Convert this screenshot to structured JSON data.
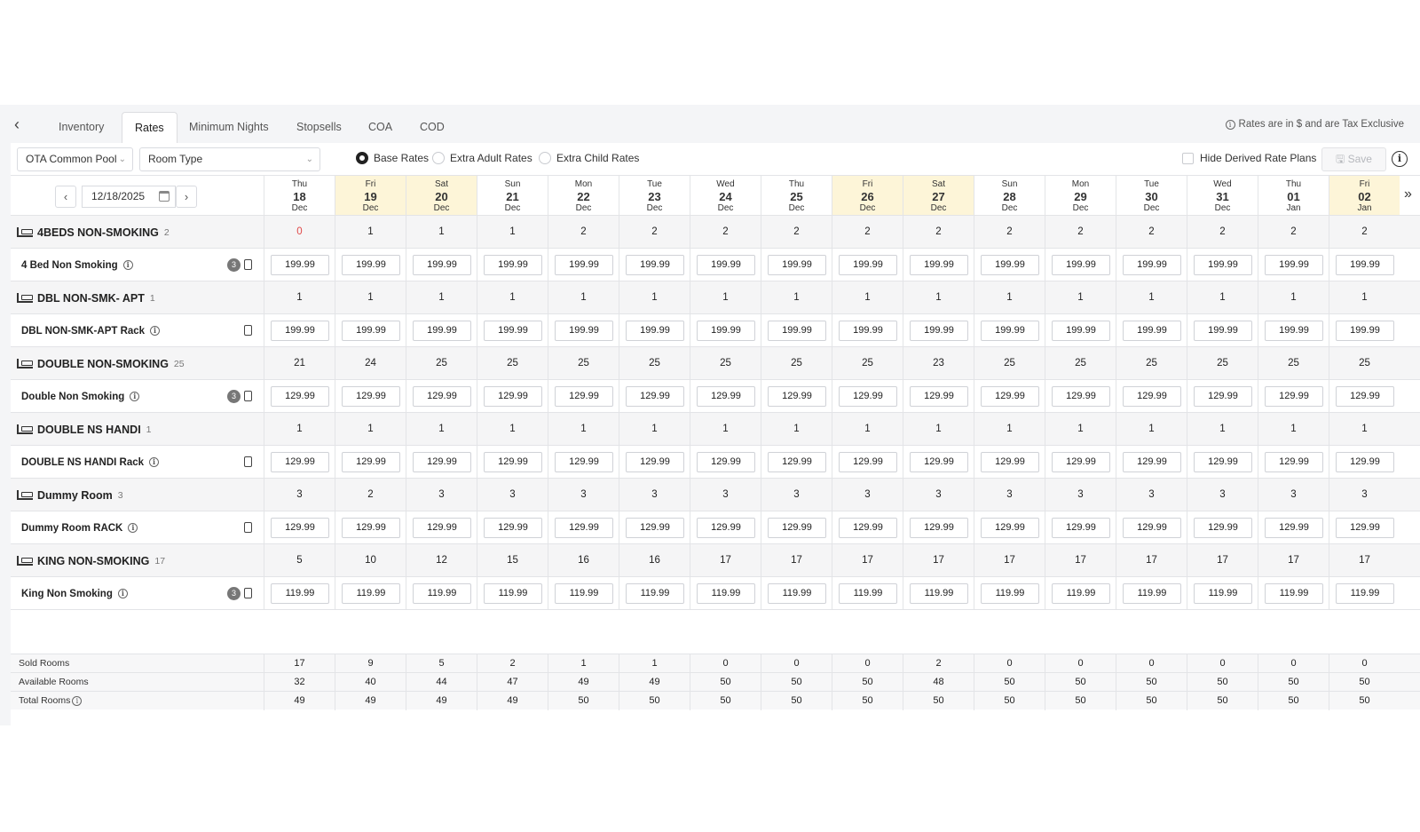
{
  "tabs": [
    "Inventory",
    "Rates",
    "Minimum Nights",
    "Stopsells",
    "COA",
    "COD"
  ],
  "active_tab": "Rates",
  "tax_note": "Rates are in $ and are Tax Exclusive",
  "toolbar": {
    "pool_select": "OTA Common Pool",
    "room_type_select": "Room Type",
    "radios": [
      {
        "label": "Base Rates",
        "selected": true
      },
      {
        "label": "Extra Adult Rates",
        "selected": false
      },
      {
        "label": "Extra Child Rates",
        "selected": false
      }
    ],
    "hide_derived_label": "Hide Derived Rate Plans",
    "save_label": "Save"
  },
  "date_input": "12/18/2025",
  "days": [
    {
      "dow": "Thu",
      "day": "18",
      "mon": "Dec",
      "weekend": false
    },
    {
      "dow": "Fri",
      "day": "19",
      "mon": "Dec",
      "weekend": true
    },
    {
      "dow": "Sat",
      "day": "20",
      "mon": "Dec",
      "weekend": true
    },
    {
      "dow": "Sun",
      "day": "21",
      "mon": "Dec",
      "weekend": false
    },
    {
      "dow": "Mon",
      "day": "22",
      "mon": "Dec",
      "weekend": false
    },
    {
      "dow": "Tue",
      "day": "23",
      "mon": "Dec",
      "weekend": false
    },
    {
      "dow": "Wed",
      "day": "24",
      "mon": "Dec",
      "weekend": false
    },
    {
      "dow": "Thu",
      "day": "25",
      "mon": "Dec",
      "weekend": false
    },
    {
      "dow": "Fri",
      "day": "26",
      "mon": "Dec",
      "weekend": true
    },
    {
      "dow": "Sat",
      "day": "27",
      "mon": "Dec",
      "weekend": true
    },
    {
      "dow": "Sun",
      "day": "28",
      "mon": "Dec",
      "weekend": false
    },
    {
      "dow": "Mon",
      "day": "29",
      "mon": "Dec",
      "weekend": false
    },
    {
      "dow": "Tue",
      "day": "30",
      "mon": "Dec",
      "weekend": false
    },
    {
      "dow": "Wed",
      "day": "31",
      "mon": "Dec",
      "weekend": false
    },
    {
      "dow": "Thu",
      "day": "01",
      "mon": "Jan",
      "weekend": false
    },
    {
      "dow": "Fri",
      "day": "02",
      "mon": "Jan",
      "weekend": true
    }
  ],
  "room_types": [
    {
      "name": "4BEDS NON-SMOKING",
      "count": "2",
      "availability": [
        "0",
        "1",
        "1",
        "1",
        "2",
        "2",
        "2",
        "2",
        "2",
        "2",
        "2",
        "2",
        "2",
        "2",
        "2",
        "2"
      ],
      "rate_plan": {
        "name": "4 Bed Non Smoking",
        "badge": "3",
        "values": [
          "199.99",
          "199.99",
          "199.99",
          "199.99",
          "199.99",
          "199.99",
          "199.99",
          "199.99",
          "199.99",
          "199.99",
          "199.99",
          "199.99",
          "199.99",
          "199.99",
          "199.99",
          "199.99"
        ]
      }
    },
    {
      "name": "DBL NON-SMK- APT",
      "count": "1",
      "availability": [
        "1",
        "1",
        "1",
        "1",
        "1",
        "1",
        "1",
        "1",
        "1",
        "1",
        "1",
        "1",
        "1",
        "1",
        "1",
        "1"
      ],
      "rate_plan": {
        "name": "DBL NON-SMK-APT Rack",
        "badge": "",
        "values": [
          "199.99",
          "199.99",
          "199.99",
          "199.99",
          "199.99",
          "199.99",
          "199.99",
          "199.99",
          "199.99",
          "199.99",
          "199.99",
          "199.99",
          "199.99",
          "199.99",
          "199.99",
          "199.99"
        ]
      }
    },
    {
      "name": "DOUBLE NON-SMOKING",
      "count": "25",
      "availability": [
        "21",
        "24",
        "25",
        "25",
        "25",
        "25",
        "25",
        "25",
        "25",
        "23",
        "25",
        "25",
        "25",
        "25",
        "25",
        "25"
      ],
      "rate_plan": {
        "name": "Double Non Smoking",
        "badge": "3",
        "values": [
          "129.99",
          "129.99",
          "129.99",
          "129.99",
          "129.99",
          "129.99",
          "129.99",
          "129.99",
          "129.99",
          "129.99",
          "129.99",
          "129.99",
          "129.99",
          "129.99",
          "129.99",
          "129.99"
        ]
      }
    },
    {
      "name": "DOUBLE NS HANDI",
      "count": "1",
      "availability": [
        "1",
        "1",
        "1",
        "1",
        "1",
        "1",
        "1",
        "1",
        "1",
        "1",
        "1",
        "1",
        "1",
        "1",
        "1",
        "1"
      ],
      "rate_plan": {
        "name": "DOUBLE NS HANDI Rack",
        "badge": "",
        "values": [
          "129.99",
          "129.99",
          "129.99",
          "129.99",
          "129.99",
          "129.99",
          "129.99",
          "129.99",
          "129.99",
          "129.99",
          "129.99",
          "129.99",
          "129.99",
          "129.99",
          "129.99",
          "129.99"
        ]
      }
    },
    {
      "name": "Dummy Room",
      "count": "3",
      "availability": [
        "3",
        "2",
        "3",
        "3",
        "3",
        "3",
        "3",
        "3",
        "3",
        "3",
        "3",
        "3",
        "3",
        "3",
        "3",
        "3"
      ],
      "rate_plan": {
        "name": "Dummy Room RACK",
        "badge": "",
        "values": [
          "129.99",
          "129.99",
          "129.99",
          "129.99",
          "129.99",
          "129.99",
          "129.99",
          "129.99",
          "129.99",
          "129.99",
          "129.99",
          "129.99",
          "129.99",
          "129.99",
          "129.99",
          "129.99"
        ]
      }
    },
    {
      "name": "KING NON-SMOKING",
      "count": "17",
      "availability": [
        "5",
        "10",
        "12",
        "15",
        "16",
        "16",
        "17",
        "17",
        "17",
        "17",
        "17",
        "17",
        "17",
        "17",
        "17",
        "17"
      ],
      "rate_plan": {
        "name": "King Non Smoking",
        "badge": "3",
        "values": [
          "119.99",
          "119.99",
          "119.99",
          "119.99",
          "119.99",
          "119.99",
          "119.99",
          "119.99",
          "119.99",
          "119.99",
          "119.99",
          "119.99",
          "119.99",
          "119.99",
          "119.99",
          "119.99"
        ]
      }
    }
  ],
  "totals": [
    {
      "label": "Sold Rooms",
      "info": false,
      "values": [
        "17",
        "9",
        "5",
        "2",
        "1",
        "1",
        "0",
        "0",
        "0",
        "2",
        "0",
        "0",
        "0",
        "0",
        "0",
        "0"
      ]
    },
    {
      "label": "Available Rooms",
      "info": false,
      "values": [
        "32",
        "40",
        "44",
        "47",
        "49",
        "49",
        "50",
        "50",
        "50",
        "48",
        "50",
        "50",
        "50",
        "50",
        "50",
        "50"
      ]
    },
    {
      "label": "Total Rooms",
      "info": true,
      "values": [
        "49",
        "49",
        "49",
        "49",
        "50",
        "50",
        "50",
        "50",
        "50",
        "50",
        "50",
        "50",
        "50",
        "50",
        "50",
        "50"
      ]
    }
  ]
}
